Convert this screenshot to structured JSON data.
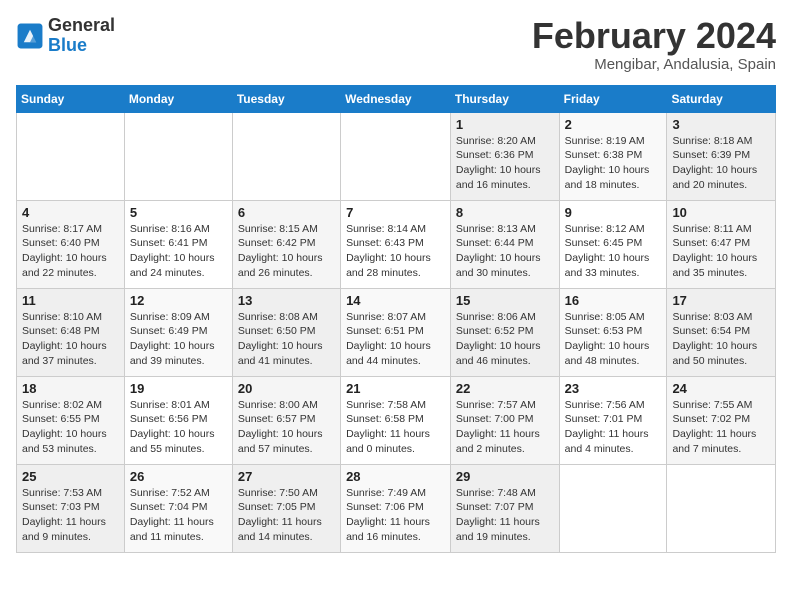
{
  "logo": {
    "line1": "General",
    "line2": "Blue"
  },
  "title": "February 2024",
  "subtitle": "Mengibar, Andalusia, Spain",
  "weekdays": [
    "Sunday",
    "Monday",
    "Tuesday",
    "Wednesday",
    "Thursday",
    "Friday",
    "Saturday"
  ],
  "weeks": [
    [
      {
        "day": "",
        "info": ""
      },
      {
        "day": "",
        "info": ""
      },
      {
        "day": "",
        "info": ""
      },
      {
        "day": "",
        "info": ""
      },
      {
        "day": "1",
        "info": "Sunrise: 8:20 AM\nSunset: 6:36 PM\nDaylight: 10 hours\nand 16 minutes."
      },
      {
        "day": "2",
        "info": "Sunrise: 8:19 AM\nSunset: 6:38 PM\nDaylight: 10 hours\nand 18 minutes."
      },
      {
        "day": "3",
        "info": "Sunrise: 8:18 AM\nSunset: 6:39 PM\nDaylight: 10 hours\nand 20 minutes."
      }
    ],
    [
      {
        "day": "4",
        "info": "Sunrise: 8:17 AM\nSunset: 6:40 PM\nDaylight: 10 hours\nand 22 minutes."
      },
      {
        "day": "5",
        "info": "Sunrise: 8:16 AM\nSunset: 6:41 PM\nDaylight: 10 hours\nand 24 minutes."
      },
      {
        "day": "6",
        "info": "Sunrise: 8:15 AM\nSunset: 6:42 PM\nDaylight: 10 hours\nand 26 minutes."
      },
      {
        "day": "7",
        "info": "Sunrise: 8:14 AM\nSunset: 6:43 PM\nDaylight: 10 hours\nand 28 minutes."
      },
      {
        "day": "8",
        "info": "Sunrise: 8:13 AM\nSunset: 6:44 PM\nDaylight: 10 hours\nand 30 minutes."
      },
      {
        "day": "9",
        "info": "Sunrise: 8:12 AM\nSunset: 6:45 PM\nDaylight: 10 hours\nand 33 minutes."
      },
      {
        "day": "10",
        "info": "Sunrise: 8:11 AM\nSunset: 6:47 PM\nDaylight: 10 hours\nand 35 minutes."
      }
    ],
    [
      {
        "day": "11",
        "info": "Sunrise: 8:10 AM\nSunset: 6:48 PM\nDaylight: 10 hours\nand 37 minutes."
      },
      {
        "day": "12",
        "info": "Sunrise: 8:09 AM\nSunset: 6:49 PM\nDaylight: 10 hours\nand 39 minutes."
      },
      {
        "day": "13",
        "info": "Sunrise: 8:08 AM\nSunset: 6:50 PM\nDaylight: 10 hours\nand 41 minutes."
      },
      {
        "day": "14",
        "info": "Sunrise: 8:07 AM\nSunset: 6:51 PM\nDaylight: 10 hours\nand 44 minutes."
      },
      {
        "day": "15",
        "info": "Sunrise: 8:06 AM\nSunset: 6:52 PM\nDaylight: 10 hours\nand 46 minutes."
      },
      {
        "day": "16",
        "info": "Sunrise: 8:05 AM\nSunset: 6:53 PM\nDaylight: 10 hours\nand 48 minutes."
      },
      {
        "day": "17",
        "info": "Sunrise: 8:03 AM\nSunset: 6:54 PM\nDaylight: 10 hours\nand 50 minutes."
      }
    ],
    [
      {
        "day": "18",
        "info": "Sunrise: 8:02 AM\nSunset: 6:55 PM\nDaylight: 10 hours\nand 53 minutes."
      },
      {
        "day": "19",
        "info": "Sunrise: 8:01 AM\nSunset: 6:56 PM\nDaylight: 10 hours\nand 55 minutes."
      },
      {
        "day": "20",
        "info": "Sunrise: 8:00 AM\nSunset: 6:57 PM\nDaylight: 10 hours\nand 57 minutes."
      },
      {
        "day": "21",
        "info": "Sunrise: 7:58 AM\nSunset: 6:58 PM\nDaylight: 11 hours\nand 0 minutes."
      },
      {
        "day": "22",
        "info": "Sunrise: 7:57 AM\nSunset: 7:00 PM\nDaylight: 11 hours\nand 2 minutes."
      },
      {
        "day": "23",
        "info": "Sunrise: 7:56 AM\nSunset: 7:01 PM\nDaylight: 11 hours\nand 4 minutes."
      },
      {
        "day": "24",
        "info": "Sunrise: 7:55 AM\nSunset: 7:02 PM\nDaylight: 11 hours\nand 7 minutes."
      }
    ],
    [
      {
        "day": "25",
        "info": "Sunrise: 7:53 AM\nSunset: 7:03 PM\nDaylight: 11 hours\nand 9 minutes."
      },
      {
        "day": "26",
        "info": "Sunrise: 7:52 AM\nSunset: 7:04 PM\nDaylight: 11 hours\nand 11 minutes."
      },
      {
        "day": "27",
        "info": "Sunrise: 7:50 AM\nSunset: 7:05 PM\nDaylight: 11 hours\nand 14 minutes."
      },
      {
        "day": "28",
        "info": "Sunrise: 7:49 AM\nSunset: 7:06 PM\nDaylight: 11 hours\nand 16 minutes."
      },
      {
        "day": "29",
        "info": "Sunrise: 7:48 AM\nSunset: 7:07 PM\nDaylight: 11 hours\nand 19 minutes."
      },
      {
        "day": "",
        "info": ""
      },
      {
        "day": "",
        "info": ""
      }
    ]
  ]
}
